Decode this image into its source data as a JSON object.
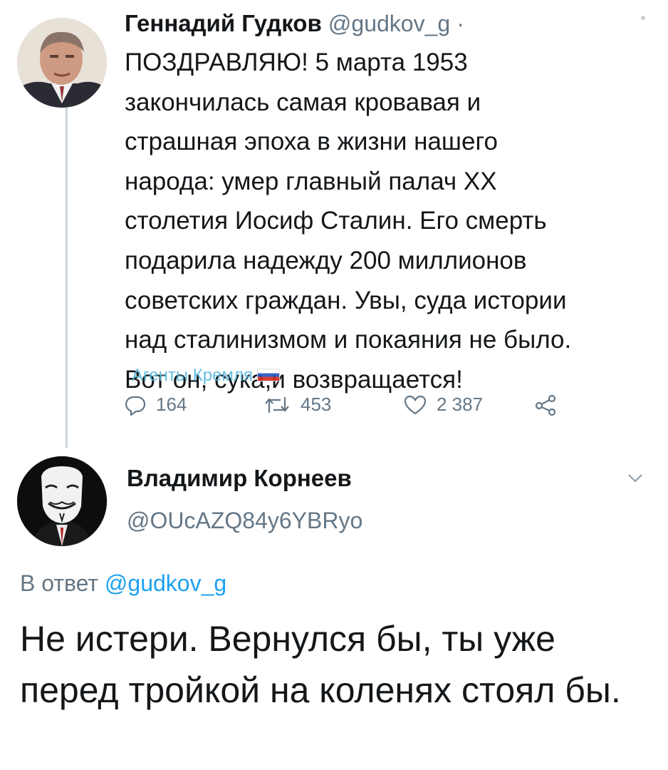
{
  "tweet": {
    "author_name": "Геннадий Гудков",
    "author_handle": "@gudkov_g",
    "handle_separator": "·",
    "text": "ПОЗДРАВЛЯЮ! 5 марта 1953\nзакончилась самая кровавая и\nстрашная эпоха в жизни нашего\nнарода: умер главный палач XX\nстолетия Иосиф Сталин. Его смерть\nподарила надежду 200 миллионов\nсоветских граждан. Увы, суда истории\nнад сталинизмом и покаяния не было.\nВот он, сука,и возвращается!",
    "watermark": "Агенты Кремля",
    "stats": {
      "replies": "164",
      "retweets": "453",
      "likes": "2 387"
    },
    "icons": [
      "reply-icon",
      "retweet-icon",
      "like-icon",
      "share-icon"
    ]
  },
  "reply": {
    "author_name": "Владимир Корнеев",
    "author_handle": "@OUcAZQ84y6YBRyo",
    "reply_prefix": "В ответ",
    "reply_to": "@gudkov_g",
    "text": "Не истери. Вернулся бы, ты уже перед тройкой на коленях стоял бы."
  },
  "colors": {
    "text": "#14171a",
    "secondary": "#657786",
    "link": "#1da1f2",
    "thread_line": "#ccd6dd"
  }
}
